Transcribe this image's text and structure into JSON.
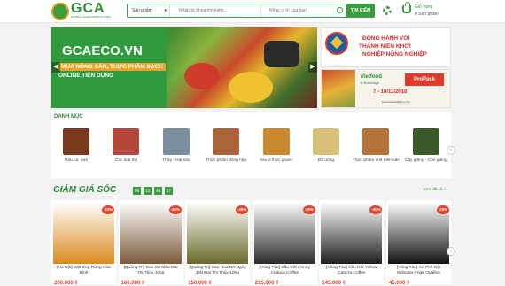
{
  "header": {
    "logo_text": "GCA",
    "logo_sub": "GLOBAL CLEAN AGRICULTURE",
    "search_category": "Sản phẩm",
    "search_keyword_placeholder": "Nhập từ khóa tìm kiếm...",
    "search_location_placeholder": "Nhập vị trí của bạn",
    "search_button": "TÌM KIẾM",
    "cart_label": "Giỏ hàng",
    "cart_count": "0 Sản phẩm"
  },
  "hero": {
    "title": "GCAECO.VN",
    "line1": "MUA NÔNG SẢN, THỰC PHẨM SẠCH",
    "line2": "ONLINE TIỆN DỤNG"
  },
  "side_banner_1": {
    "line1": "ĐỒNG HÀNH VỚI",
    "line2": "THANH NIÊN KHỞI",
    "line3": "NGHIỆP NÔNG NGHIỆP"
  },
  "side_banner_2": {
    "logo1": "Vietfood",
    "logo1b": "& Beverage",
    "logo2": "ProPack",
    "date": "7 - 10/11/2018",
    "url": "www.foodexhibition.com"
  },
  "categories": {
    "title": "DANH MỤC",
    "items": [
      {
        "label": "Rau củ, quả",
        "color": "#7a3a1e"
      },
      {
        "label": "Các loại thịt",
        "color": "#b5473a"
      },
      {
        "label": "Thủy - Hải sản",
        "color": "#7c8fa0"
      },
      {
        "label": "Thực phẩm đóng hộp",
        "color": "#a8643a"
      },
      {
        "label": "Gia vị thực phẩm",
        "color": "#c9872e"
      },
      {
        "label": "Đồ uống",
        "color": "#d9c079"
      },
      {
        "label": "Thực phẩm chế biến sẵn",
        "color": "#b6743a"
      },
      {
        "label": "Cây giống - Con giống",
        "color": "#3a5a2a"
      }
    ]
  },
  "deals": {
    "title": "GIẢM GIÁ SỐC",
    "timer": [
      "06",
      "13",
      "46",
      "17"
    ],
    "view_all": "Xem tất cả »",
    "products": [
      {
        "name": "[Hà Nội] Mật Ong Rừng Hòa Bình",
        "price": "200.000 ₫",
        "discount": "-23%",
        "color": "#d98a1e"
      },
      {
        "name": "[Quảng Trị] Cao Cô Mãu Mai Thi Thúy 100g",
        "price": "160.000 ₫",
        "discount": "-36%",
        "color": "#7a5a3a"
      },
      {
        "name": "[Quảng Trị] Cao Hoa Nở Ngày Đất Mai Thi Thúy 100g",
        "price": "150.000 ₫",
        "discount": "-38%",
        "color": "#6a6a2a"
      },
      {
        "name": "[Vũng Tàu] Cầu Đất Honey Arabica Coffee",
        "price": "215.000 ₫",
        "discount": "-36%",
        "color": "#2a2a2a"
      },
      {
        "name": "[Vũng Tàu] Cầu Đất Yellow Caturra Coffee",
        "price": "145.000 ₫",
        "discount": "-30%",
        "color": "#1e1e1e"
      },
      {
        "name": "[Vũng Tàu] Cà Phê Bột Robusta (High Quality)",
        "price": "45.000 ₫",
        "discount": "-29%",
        "color": "#111111"
      }
    ]
  },
  "colors": {
    "brand": "#3a9b3f",
    "sale": "#e2432a"
  }
}
